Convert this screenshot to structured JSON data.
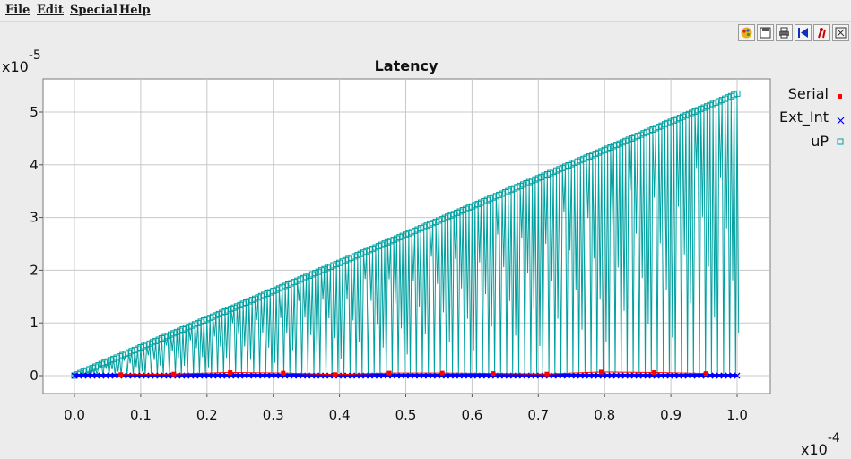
{
  "menu": [
    {
      "label": "File"
    },
    {
      "label": "Edit"
    },
    {
      "label": "Special"
    },
    {
      "label": "Help"
    }
  ],
  "toolbar": [
    {
      "icon": "palette-icon"
    },
    {
      "icon": "save-icon"
    },
    {
      "icon": "print-icon"
    },
    {
      "icon": "reset-view-icon"
    },
    {
      "icon": "marker-icon"
    },
    {
      "icon": "fit-view-icon"
    }
  ],
  "chart_data": {
    "type": "scatter",
    "title": "Latency",
    "x_exponent_label": "x10",
    "x_exponent": "-4",
    "y_exponent_label": "x10",
    "y_exponent": "-5",
    "xlim": [
      -0.05,
      1.05
    ],
    "ylim": [
      -0.3,
      5.6
    ],
    "xticks": [
      "0.0",
      "0.1",
      "0.2",
      "0.3",
      "0.4",
      "0.5",
      "0.6",
      "0.7",
      "0.8",
      "0.9",
      "1.0"
    ],
    "yticks": [
      "0",
      "1",
      "2",
      "3",
      "4",
      "5"
    ],
    "grid": true,
    "legend_position": "right",
    "series": [
      {
        "name": "Serial",
        "color": "#ff0000",
        "marker": "square",
        "x": [
          0.07,
          0.15,
          0.235,
          0.315,
          0.393,
          0.475,
          0.555,
          0.632,
          0.713,
          0.795,
          0.875,
          0.953
        ],
        "y": [
          0.02,
          0.03,
          0.06,
          0.05,
          0.02,
          0.05,
          0.05,
          0.04,
          0.03,
          0.07,
          0.06,
          0.04
        ]
      },
      {
        "name": "Ext_Int",
        "color": "#0000ff",
        "marker": "x",
        "x_range": [
          0.0,
          1.0
        ],
        "y_value": 0.0
      },
      {
        "name": "uP",
        "color": "#00a0a0",
        "marker": "open-square",
        "x_range": [
          0.0,
          1.0
        ],
        "y_max_range": [
          0.0,
          5.35
        ],
        "shape": "sawtooth"
      }
    ]
  }
}
